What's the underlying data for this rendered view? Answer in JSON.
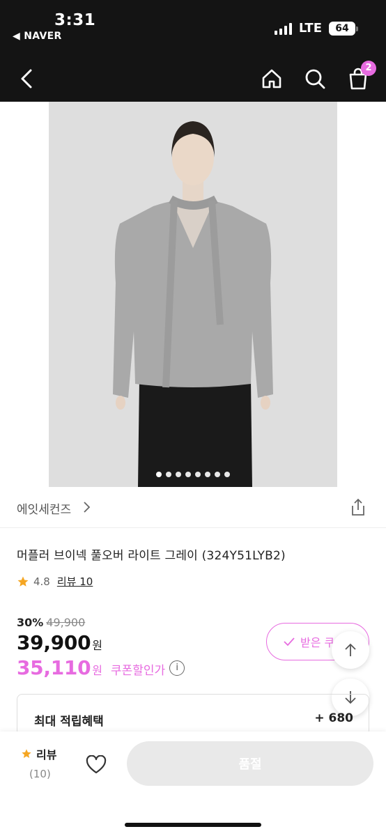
{
  "status_bar": {
    "time": "3:31",
    "back_app": "◀ NAVER",
    "network": "LTE",
    "battery": "64"
  },
  "nav": {
    "cart_count": "2",
    "icons": [
      "back-icon",
      "home-icon",
      "search-icon",
      "shopping-bag-icon"
    ]
  },
  "gallery": {
    "image_count": 8,
    "active_index": 0
  },
  "brand": {
    "name": "에잇세컨즈"
  },
  "product": {
    "title": "머플러 브이넥 풀오버 라이트 그레이 (324Y51LYB2)",
    "rating": "4.8",
    "review_label": "리뷰 10"
  },
  "price": {
    "discount_rate": "30%",
    "original": "49,900",
    "sale": "39,900",
    "currency": "원",
    "coupon_price": "35,110",
    "coupon_label": "쿠폰할인가",
    "info_symbol": "i"
  },
  "coupon_button": {
    "label": "받은 쿠"
  },
  "benefit": {
    "label": "최대 적립혜택",
    "value": "+ 680"
  },
  "bottom_bar": {
    "review_label": "리뷰",
    "review_count": "(10)",
    "soldout_label": "품절"
  },
  "colors": {
    "accent": "#e76be0",
    "header_bg": "#141414",
    "star": "#f5a623"
  }
}
